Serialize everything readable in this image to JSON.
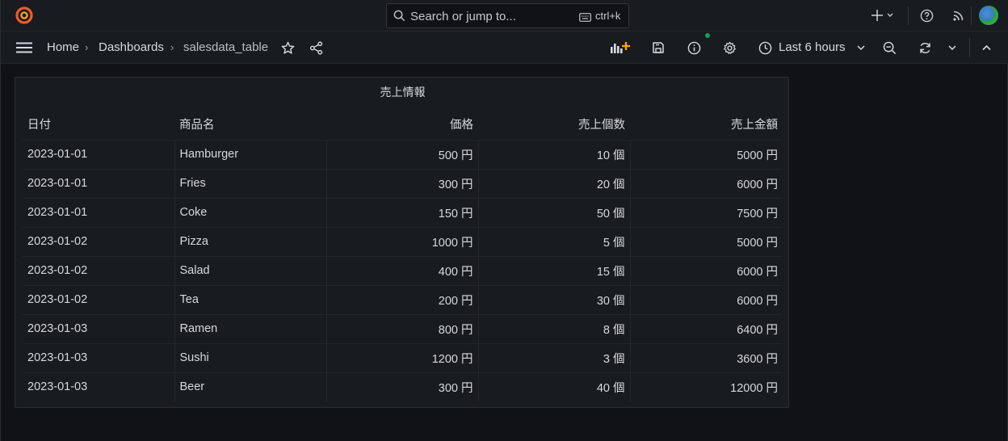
{
  "topbar": {
    "search_placeholder": "Search or jump to...",
    "shortcut": "ctrl+k"
  },
  "breadcrumb": {
    "home": "Home",
    "dashboards": "Dashboards",
    "current": "salesdata_table",
    "separator": "›"
  },
  "toolbar": {
    "time_range": "Last 6 hours"
  },
  "panel": {
    "title": "売上情報",
    "columns": [
      "日付",
      "商品名",
      "価格",
      "売上個数",
      "売上金額"
    ],
    "rows": [
      [
        "2023-01-01",
        "Hamburger",
        "500 円",
        "10 個",
        "5000 円"
      ],
      [
        "2023-01-01",
        "Fries",
        "300 円",
        "20 個",
        "6000 円"
      ],
      [
        "2023-01-01",
        "Coke",
        "150 円",
        "50 個",
        "7500 円"
      ],
      [
        "2023-01-02",
        "Pizza",
        "1000 円",
        "5 個",
        "5000 円"
      ],
      [
        "2023-01-02",
        "Salad",
        "400 円",
        "15 個",
        "6000 円"
      ],
      [
        "2023-01-02",
        "Tea",
        "200 円",
        "30 個",
        "6000 円"
      ],
      [
        "2023-01-03",
        "Ramen",
        "800 円",
        "8 個",
        "6400 円"
      ],
      [
        "2023-01-03",
        "Sushi",
        "1200 円",
        "3 個",
        "3600 円"
      ],
      [
        "2023-01-03",
        "Beer",
        "300 円",
        "40 個",
        "12000 円"
      ]
    ]
  },
  "colors": {
    "background": "#111217",
    "panel": "#181b1f",
    "logo": "#f05a28",
    "accent_green": "#1a9c5b"
  }
}
